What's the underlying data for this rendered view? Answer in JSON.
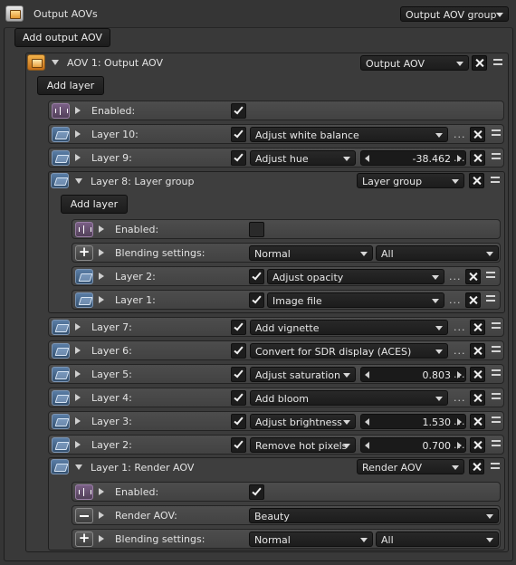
{
  "root": {
    "title": "Output AOVs",
    "type_dropdown": "Output AOV group",
    "add_button": "Add output AOV"
  },
  "aov1": {
    "title": "AOV 1: Output AOV",
    "type_dropdown": "Output AOV",
    "add_button": "Add layer"
  },
  "rows": {
    "enabled": "Enabled:",
    "layer10": {
      "label": "Layer 10:",
      "value": "Adjust white balance"
    },
    "layer9": {
      "label": "Layer 9:",
      "value": "Adjust hue",
      "number": "-38.462"
    },
    "layer8": {
      "label": "Layer 8: Layer group",
      "type_dropdown": "Layer group",
      "add_button": "Add layer"
    },
    "layer8_enabled": "Enabled:",
    "layer8_blending": {
      "label": "Blending settings:",
      "mode": "Normal",
      "channels": "All"
    },
    "layer8_2": {
      "label": "Layer 2:",
      "value": "Adjust opacity"
    },
    "layer8_1": {
      "label": "Layer 1:",
      "value": "Image file"
    },
    "layer7": {
      "label": "Layer 7:",
      "value": "Add vignette"
    },
    "layer6": {
      "label": "Layer 6:",
      "value": "Convert for SDR display (ACES)"
    },
    "layer5": {
      "label": "Layer 5:",
      "value": "Adjust saturation",
      "number": "0.803"
    },
    "layer4": {
      "label": "Layer 4:",
      "value": "Add bloom"
    },
    "layer3": {
      "label": "Layer 3:",
      "value": "Adjust brightness",
      "number": "1.530"
    },
    "layer2": {
      "label": "Layer 2:",
      "value": "Remove hot pixels",
      "number": "0.700"
    },
    "layer1": {
      "label": "Layer 1: Render AOV",
      "type_dropdown": "Render AOV"
    },
    "layer1_enabled": "Enabled:",
    "layer1_render": {
      "label": "Render AOV:",
      "value": "Beauty"
    },
    "layer1_blending": {
      "label": "Blending settings:",
      "mode": "Normal",
      "channels": "All"
    }
  },
  "more_glyph": "...",
  "icons": [
    "aov-node-icon",
    "layer-icon",
    "enabled-toggle-icon",
    "blending-plus-icon",
    "render-aov-minus-icon",
    "close-icon",
    "menu-icon",
    "checkbox-tick-icon"
  ]
}
